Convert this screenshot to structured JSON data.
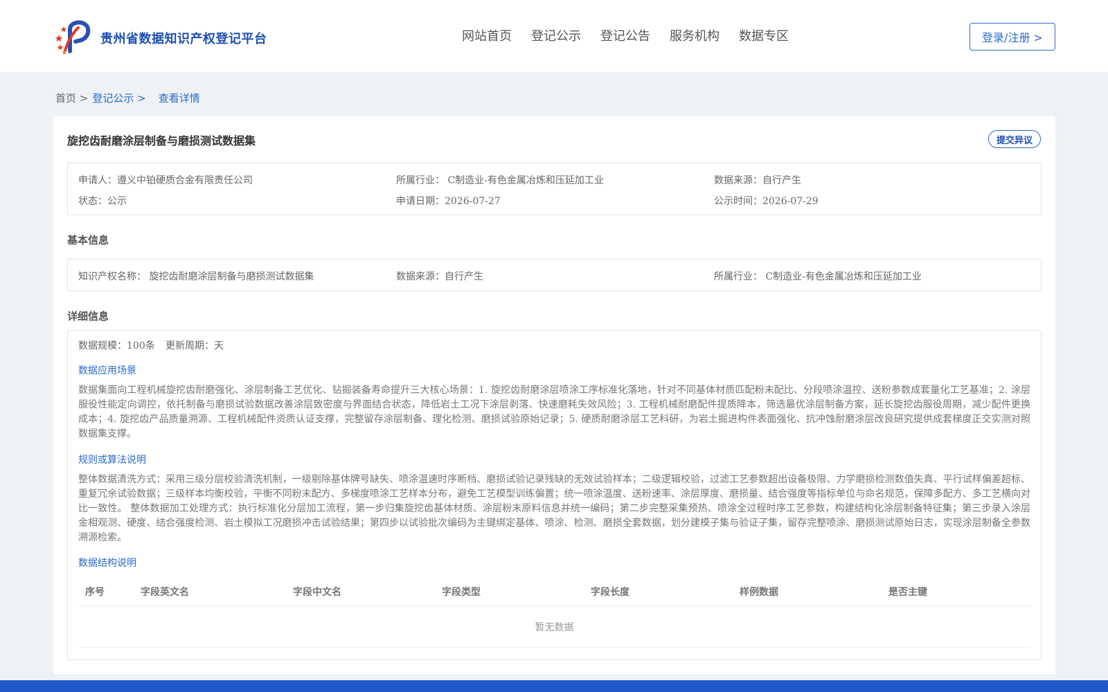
{
  "header": {
    "brand": "贵州省数据知识产权登记平台",
    "nav": [
      "网站首页",
      "登记公示",
      "登记公告",
      "服务机构",
      "数据专区"
    ],
    "login": "登录/注册 >"
  },
  "breadcrumb": {
    "home": "首页 >",
    "section": "登记公示 >",
    "current": "查看详情"
  },
  "dataset": {
    "title": "旋挖齿耐磨涂层制备与磨损测试数据集",
    "objection_button": "提交异议"
  },
  "summary": {
    "applicant": "申请人：遵义中铂硬质合金有限责任公司",
    "industry": "所属行业： C制造业-有色金属冶炼和压延加工业",
    "source": "数据来源：自行产生",
    "status": "状态：公示",
    "apply_date": "申请日期：2026-07-27",
    "publish_date": "公示时间：2026-07-29"
  },
  "basic": {
    "heading": "基本信息",
    "ip_name": "知识产权名称： 旋挖齿耐磨涂层制备与磨损测试数据集",
    "source": "数据来源：自行产生",
    "industry": "所属行业： C制造业-有色金属冶炼和压延加工业"
  },
  "detail": {
    "heading": "详细信息",
    "scale": "数据规模：100条",
    "cycle": "更新周期：天",
    "scenario_heading": "数据应用场景",
    "scenario_text": "数据集面向工程机械旋挖齿耐磨强化、涂层制备工艺优化、钻掘装备寿命提升三大核心场景：1. 旋挖齿耐磨涂层喷涂工序标准化落地，针对不同基体材质匹配粉末配比、分段喷涂温控、送粉参数成套量化工艺基准；2. 涂层服役性能定向调控，依托制备与磨损试验数据改善涂层致密度与界面结合状态，降低岩土工况下涂层剥落、快速磨耗失效风险；3. 工程机械耐磨配件提质降本，筛选最优涂层制备方案，延长旋挖齿服役周期，减少配件更换成本；4. 旋挖齿产品质量溯源、工程机械配件资质认证支撑，完整留存涂层制备、理化检测、磨损试验原始记录；5. 硬质耐磨涂层工艺科研，为岩土掘进构件表面强化、抗冲蚀耐磨涂层改良研究提供成套梯度正交实测对照数据集支撑。",
    "rules_heading": "规则或算法说明",
    "rules_text": "整体数据清洗方式：采用三级分层校验清洗机制，一级剔除基体牌号缺失、喷涂温速时序断档、磨损试验记录残缺的无效试验样本；二级逻辑校验，过滤工艺参数超出设备极限、力学磨损检测数值失真、平行试样偏差超标、重复冗余试验数据；三级样本均衡校验，平衡不同粉末配方、多梯度喷涂工艺样本分布，避免工艺模型训练偏置；统一喷涂温度、送粉速率、涂层厚度、磨损量、结合强度等指标单位与命名规范，保障多配方、多工艺横向对比一致性。 整体数据加工处理方式：执行标准化分层加工流程，第一步归集旋挖齿基体材质、涂层粉末原料信息并统一编码；第二步完整采集预热、喷涂全过程时序工艺参数，构建结构化涂层制备特征集；第三步录入涂层金相观测、硬度、结合强度检测、岩土模拟工况磨损冲击试验结果；第四步以试验批次编码为主键绑定基体、喷涂、检测、磨损全套数据，划分建模子集与验证子集，留存完整喷涂、磨损测试原始日志，实现涂层制备全参数溯源检索。",
    "structure_heading": "数据结构说明",
    "table_headers": [
      "序号",
      "字段英文名",
      "字段中文名",
      "字段类型",
      "字段长度",
      "样例数据",
      "是否主键"
    ],
    "empty_text": "暂无数据"
  },
  "colors": {
    "primary": "#2b6ac9",
    "brand": "#1f4fb2",
    "footer": "#2358c8",
    "page_bg": "#eef2f5"
  }
}
